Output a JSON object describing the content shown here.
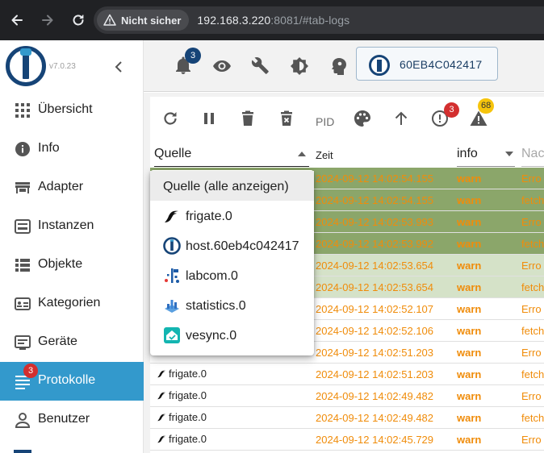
{
  "browser": {
    "security_label": "Nicht sicher",
    "url_host": "192.168.3.220",
    "url_rest": ":8081/#tab-logs"
  },
  "sidebar": {
    "version": "v7.0.23",
    "items": [
      {
        "label": "Übersicht",
        "icon": "grid-icon"
      },
      {
        "label": "Info",
        "icon": "info-icon"
      },
      {
        "label": "Adapter",
        "icon": "store-icon"
      },
      {
        "label": "Instanzen",
        "icon": "instances-icon"
      },
      {
        "label": "Objekte",
        "icon": "list-icon"
      },
      {
        "label": "Kategorien",
        "icon": "categories-icon"
      },
      {
        "label": "Geräte",
        "icon": "devices-icon"
      },
      {
        "label": "Protokolle",
        "icon": "logs-icon",
        "badge": "3",
        "active": true
      },
      {
        "label": "Benutzer",
        "icon": "user-icon"
      }
    ]
  },
  "toolbar": {
    "notifications_badge": "3",
    "host": "60EB4C042417"
  },
  "log_toolbar": {
    "pid_label": "PID",
    "error_badge": "3",
    "warn_badge": "68"
  },
  "columns": {
    "source": "Quelle",
    "time": "Zeit",
    "severity": "info",
    "message": "Nac"
  },
  "dropdown": {
    "options": [
      {
        "label": "Quelle (alle anzeigen)",
        "icon": ""
      },
      {
        "label": "frigate.0",
        "icon": "frigate-icon"
      },
      {
        "label": "host.60eb4c042417",
        "icon": "iobroker-icon"
      },
      {
        "label": "labcom.0",
        "icon": "labcom-icon"
      },
      {
        "label": "statistics.0",
        "icon": "statistics-icon"
      },
      {
        "label": "vesync.0",
        "icon": "vesync-icon"
      }
    ]
  },
  "logs": [
    {
      "source": "",
      "time": "2024-09-12 14:02:54.155",
      "severity": "warn",
      "message": "Erro",
      "highlight": "dark"
    },
    {
      "source": "",
      "time": "2024-09-12 14:02:54.155",
      "severity": "warn",
      "message": "fetch",
      "highlight": "dark"
    },
    {
      "source": "",
      "time": "2024-09-12 14:02:53.993",
      "severity": "warn",
      "message": "Erro",
      "highlight": "dark"
    },
    {
      "source": "",
      "time": "2024-09-12 14:02:53.992",
      "severity": "warn",
      "message": "fetch",
      "highlight": "dark"
    },
    {
      "source": "",
      "time": "2024-09-12 14:02:53.654",
      "severity": "warn",
      "message": "Erro",
      "highlight": "light"
    },
    {
      "source": "",
      "time": "2024-09-12 14:02:53.654",
      "severity": "warn",
      "message": "fetch",
      "highlight": "light"
    },
    {
      "source": "",
      "time": "2024-09-12 14:02:52.107",
      "severity": "warn",
      "message": "Erro",
      "highlight": ""
    },
    {
      "source": "",
      "time": "2024-09-12 14:02:52.106",
      "severity": "warn",
      "message": "fetch",
      "highlight": ""
    },
    {
      "source": "",
      "time": "2024-09-12 14:02:51.203",
      "severity": "warn",
      "message": "Erro",
      "highlight": ""
    },
    {
      "source": "frigate.0",
      "time": "2024-09-12 14:02:51.203",
      "severity": "warn",
      "message": "fetch",
      "highlight": ""
    },
    {
      "source": "frigate.0",
      "time": "2024-09-12 14:02:49.482",
      "severity": "warn",
      "message": "Erro",
      "highlight": ""
    },
    {
      "source": "frigate.0",
      "time": "2024-09-12 14:02:49.482",
      "severity": "warn",
      "message": "fetch",
      "highlight": ""
    },
    {
      "source": "frigate.0",
      "time": "2024-09-12 14:02:45.729",
      "severity": "warn",
      "message": "Erro",
      "highlight": ""
    }
  ],
  "colors": {
    "accent": "#3399cc",
    "brand": "#164477",
    "warn_text": "#f08c0a",
    "error_badge": "#d32f2f",
    "warn_badge": "#f6c40c"
  }
}
